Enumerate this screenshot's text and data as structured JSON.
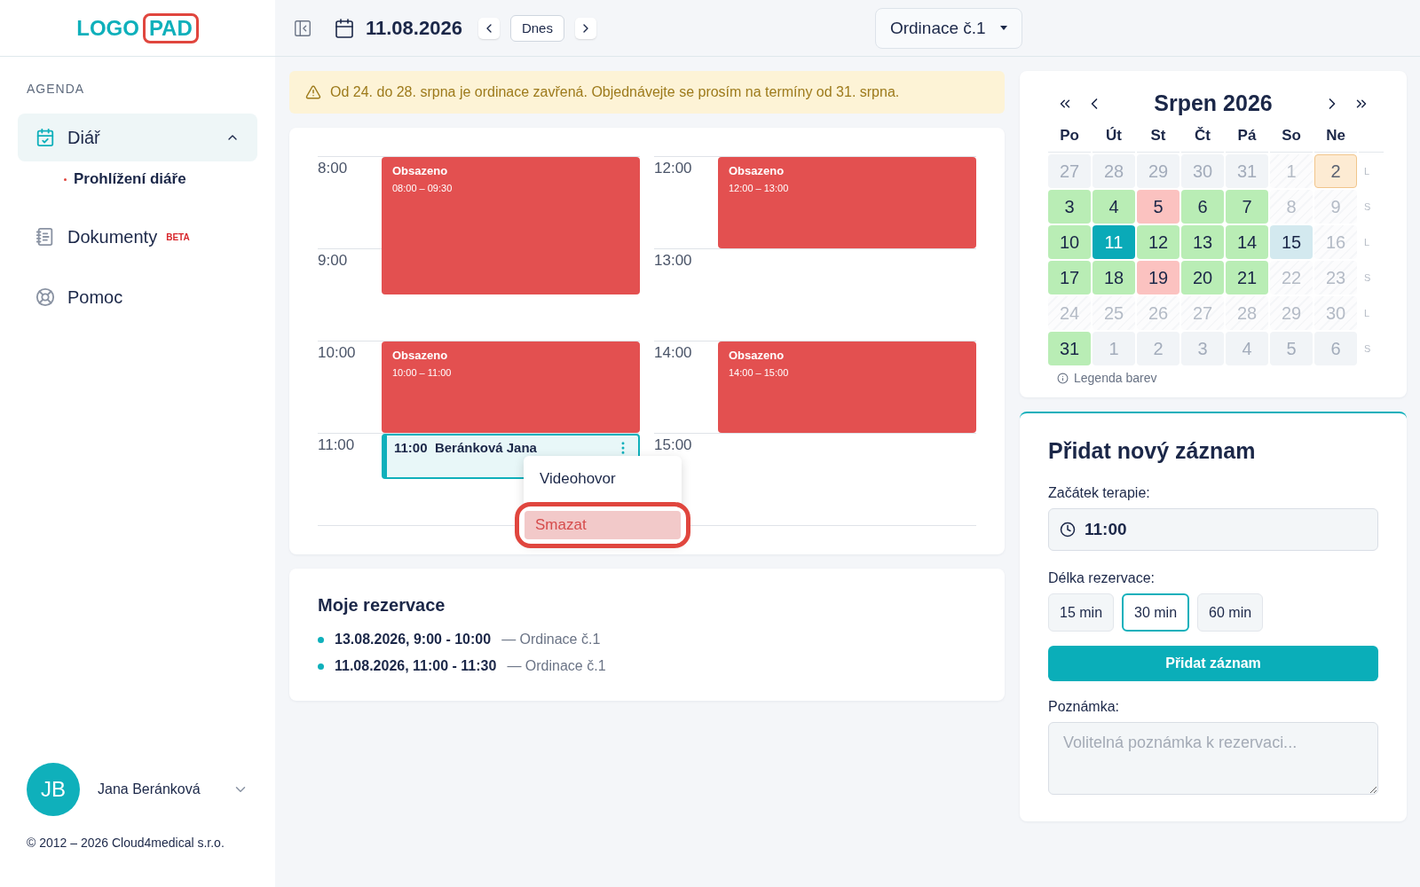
{
  "logo": {
    "part_1": "LOGO",
    "part_2": "PAD"
  },
  "sidebar": {
    "section": "AGENDA",
    "items": [
      {
        "label": "Diář",
        "selected": true,
        "expanded": true,
        "children": [
          {
            "label": "Prohlížení diáře",
            "selected": true
          }
        ]
      },
      {
        "label": "Dokumenty",
        "badge": "BETA",
        "selected": false
      },
      {
        "label": "Pomoc",
        "selected": false
      }
    ],
    "user": {
      "initials": "JB",
      "name": "Jana Beránková"
    },
    "copyright": "© 2012 – 2026 Cloud4medical s.r.o."
  },
  "toolbar": {
    "date": "11.08.2026",
    "today_button": "Dnes",
    "location": "Ordinace č.1"
  },
  "alert": "Od 24. do 28. srpna je ordinace zavřená. Objednávejte se prosím na termíny od 31. srpna.",
  "schedule": {
    "columns": [
      {
        "hours": [
          "8:00",
          "9:00",
          "10:00",
          "11:00"
        ],
        "events": [
          {
            "kind": "busy",
            "title": "Obsazeno",
            "time": "08:00 – 09:30"
          },
          {
            "kind": "busy",
            "title": "Obsazeno",
            "time": "10:00 – 11:00"
          },
          {
            "kind": "booking",
            "time": "11:00",
            "title": "Beránková Jana",
            "menu": [
              {
                "label": "Videohovor",
                "selected": false
              },
              {
                "label": "Smazat",
                "selected": true
              }
            ]
          }
        ]
      },
      {
        "hours": [
          "12:00",
          "13:00",
          "14:00",
          "15:00"
        ],
        "events": [
          {
            "kind": "busy",
            "title": "Obsazeno",
            "time": "12:00 – 13:00"
          },
          {
            "kind": "busy",
            "title": "Obsazeno",
            "time": "14:00 – 15:00"
          }
        ]
      }
    ]
  },
  "reservations": {
    "title": "Moje rezervace",
    "items": [
      {
        "when": "13.08.2026, 9:00 - 10:00",
        "where": "— Ordinace č.1"
      },
      {
        "when": "11.08.2026, 11:00 - 11:30",
        "where": "— Ordinace č.1"
      }
    ]
  },
  "calendar": {
    "title": "Srpen 2026",
    "weekdays": [
      "Po",
      "Út",
      "St",
      "Čt",
      "Pá",
      "So",
      "Ne"
    ],
    "weeks": [
      {
        "parity": "L",
        "days": [
          {
            "label": "27",
            "kind": "outside",
            "selected": false
          },
          {
            "label": "28",
            "kind": "outside",
            "selected": false
          },
          {
            "label": "29",
            "kind": "outside",
            "selected": false
          },
          {
            "label": "30",
            "kind": "outside",
            "selected": false
          },
          {
            "label": "31",
            "kind": "outside",
            "selected": false
          },
          {
            "label": "1",
            "kind": "closed",
            "selected": false
          },
          {
            "label": "2",
            "kind": "marked",
            "selected": false
          }
        ]
      },
      {
        "parity": "S",
        "days": [
          {
            "label": "3",
            "kind": "free",
            "selected": false
          },
          {
            "label": "4",
            "kind": "free",
            "selected": false
          },
          {
            "label": "5",
            "kind": "full",
            "selected": false
          },
          {
            "label": "6",
            "kind": "free",
            "selected": false
          },
          {
            "label": "7",
            "kind": "free",
            "selected": false
          },
          {
            "label": "8",
            "kind": "closed",
            "selected": false
          },
          {
            "label": "9",
            "kind": "closed",
            "selected": false
          }
        ]
      },
      {
        "parity": "L",
        "days": [
          {
            "label": "10",
            "kind": "free",
            "selected": false
          },
          {
            "label": "11",
            "kind": "free",
            "selected": true
          },
          {
            "label": "12",
            "kind": "free",
            "selected": false
          },
          {
            "label": "13",
            "kind": "free",
            "selected": false
          },
          {
            "label": "14",
            "kind": "free",
            "selected": false
          },
          {
            "label": "15",
            "kind": "partial",
            "selected": false
          },
          {
            "label": "16",
            "kind": "closed",
            "selected": false
          }
        ]
      },
      {
        "parity": "S",
        "days": [
          {
            "label": "17",
            "kind": "free",
            "selected": false
          },
          {
            "label": "18",
            "kind": "free",
            "selected": false
          },
          {
            "label": "19",
            "kind": "full",
            "selected": false
          },
          {
            "label": "20",
            "kind": "free",
            "selected": false
          },
          {
            "label": "21",
            "kind": "free",
            "selected": false
          },
          {
            "label": "22",
            "kind": "closed",
            "selected": false
          },
          {
            "label": "23",
            "kind": "closed",
            "selected": false
          }
        ]
      },
      {
        "parity": "L",
        "days": [
          {
            "label": "24",
            "kind": "closed",
            "selected": false
          },
          {
            "label": "25",
            "kind": "closed",
            "selected": false
          },
          {
            "label": "26",
            "kind": "closed",
            "selected": false
          },
          {
            "label": "27",
            "kind": "closed",
            "selected": false
          },
          {
            "label": "28",
            "kind": "closed",
            "selected": false
          },
          {
            "label": "29",
            "kind": "closed",
            "selected": false
          },
          {
            "label": "30",
            "kind": "closed",
            "selected": false
          }
        ]
      },
      {
        "parity": "S",
        "days": [
          {
            "label": "31",
            "kind": "free",
            "selected": false
          },
          {
            "label": "1",
            "kind": "outside",
            "selected": false
          },
          {
            "label": "2",
            "kind": "outside",
            "selected": false
          },
          {
            "label": "3",
            "kind": "outside",
            "selected": false
          },
          {
            "label": "4",
            "kind": "outside",
            "selected": false
          },
          {
            "label": "5",
            "kind": "outside",
            "selected": false
          },
          {
            "label": "6",
            "kind": "outside",
            "selected": false
          }
        ]
      }
    ],
    "legend": "Legenda barev"
  },
  "form": {
    "title": "Přidat nový záznam",
    "start_label": "Začátek terapie:",
    "start_value": "11:00",
    "length_label": "Délka rezervace:",
    "lengths": [
      {
        "label": "15 min",
        "selected": false
      },
      {
        "label": "30 min",
        "selected": true
      },
      {
        "label": "60 min",
        "selected": false
      }
    ],
    "submit": "Přidat záznam",
    "note_label": "Poznámka:",
    "note_placeholder": "Volitelná poznámka k rezervaci..."
  }
}
